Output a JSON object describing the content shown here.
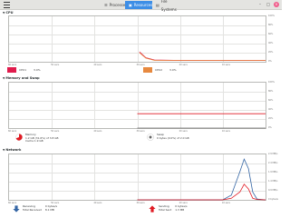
{
  "window": {
    "tabs": [
      {
        "label": "Processes",
        "icon": "list-icon"
      },
      {
        "label": "Resources",
        "icon": "resources-icon",
        "active": true
      },
      {
        "label": "File Systems",
        "icon": "drive-icon"
      }
    ],
    "controls": [
      "–",
      "□",
      "×"
    ]
  },
  "cpu": {
    "title": "CPU",
    "legend": [
      {
        "label": "CPU1",
        "value": "3.0%",
        "color": "#e01b4c"
      },
      {
        "label": "CPU2",
        "value": "3.0%",
        "color": "#e7893f"
      }
    ]
  },
  "memory": {
    "title": "Memory and Swap",
    "memory_label": "Memory",
    "memory_detail": "1.2 GB (31.6%) of 3.8 GB",
    "cache_detail": "Cache 1.9 GB",
    "swap_label": "Swap",
    "swap_detail": "0 bytes (0.0%) of 2.0 GB",
    "memory_color": "#e01b24",
    "swap_color": "#666666"
  },
  "network": {
    "title": "Network",
    "receiving_label": "Receiving",
    "receiving_rate": "0 bytes/s",
    "total_received_label": "Total Received",
    "total_received": "8.1 MB",
    "sending_label": "Sending",
    "sending_rate": "0 bytes/s",
    "total_sent_label": "Total Sent",
    "total_sent": "1.3 MB",
    "receiving_color": "#3465a4",
    "sending_color": "#e01b24"
  },
  "axes": {
    "percent_ticks": [
      "100%",
      "80%",
      "60%",
      "40%",
      "20%",
      "0%"
    ],
    "time_ticks": [
      "60 secs",
      "50 secs",
      "40 secs",
      "30 secs",
      "20 secs",
      "10 secs"
    ],
    "net_ticks": [
      "2.9 MB/s",
      "2.4 MB/s",
      "1.9 MB/s",
      "1.4 MB/s",
      "0.9 MB/s",
      "0 bytes/s"
    ]
  },
  "chart_data": [
    {
      "type": "line",
      "title": "CPU",
      "x": [
        60,
        50,
        40,
        30,
        29.5,
        28,
        26,
        20,
        10,
        0
      ],
      "series": [
        {
          "name": "CPU1",
          "values": [
            null,
            null,
            null,
            null,
            22,
            9,
            4,
            3,
            3,
            3
          ]
        },
        {
          "name": "CPU2",
          "values": [
            null,
            null,
            null,
            null,
            20,
            8,
            3,
            3,
            3,
            3
          ]
        }
      ],
      "ylim": [
        0,
        100
      ]
    },
    {
      "type": "line",
      "title": "Memory and Swap",
      "x": [
        60,
        50,
        40,
        30,
        20,
        10,
        0
      ],
      "series": [
        {
          "name": "Memory",
          "values": [
            null,
            null,
            null,
            31.6,
            31.6,
            31.6,
            31.6
          ]
        },
        {
          "name": "Swap",
          "values": [
            null,
            null,
            null,
            0,
            0,
            0,
            0
          ]
        }
      ],
      "ylim": [
        0,
        100
      ]
    },
    {
      "type": "line",
      "title": "Network",
      "x": [
        60,
        50,
        40,
        30,
        20,
        10,
        8,
        6,
        5,
        4,
        3,
        2,
        0
      ],
      "series": [
        {
          "name": "Receiving",
          "values": [
            null,
            null,
            null,
            0,
            0,
            0,
            0.3,
            1.8,
            2.6,
            2.0,
            0.5,
            0.05,
            0
          ]
        },
        {
          "name": "Sending",
          "values": [
            null,
            null,
            null,
            0,
            0,
            0,
            0.1,
            0.5,
            1.0,
            0.7,
            0.1,
            0.02,
            0
          ]
        }
      ],
      "ylim": [
        0,
        2.9
      ]
    }
  ]
}
